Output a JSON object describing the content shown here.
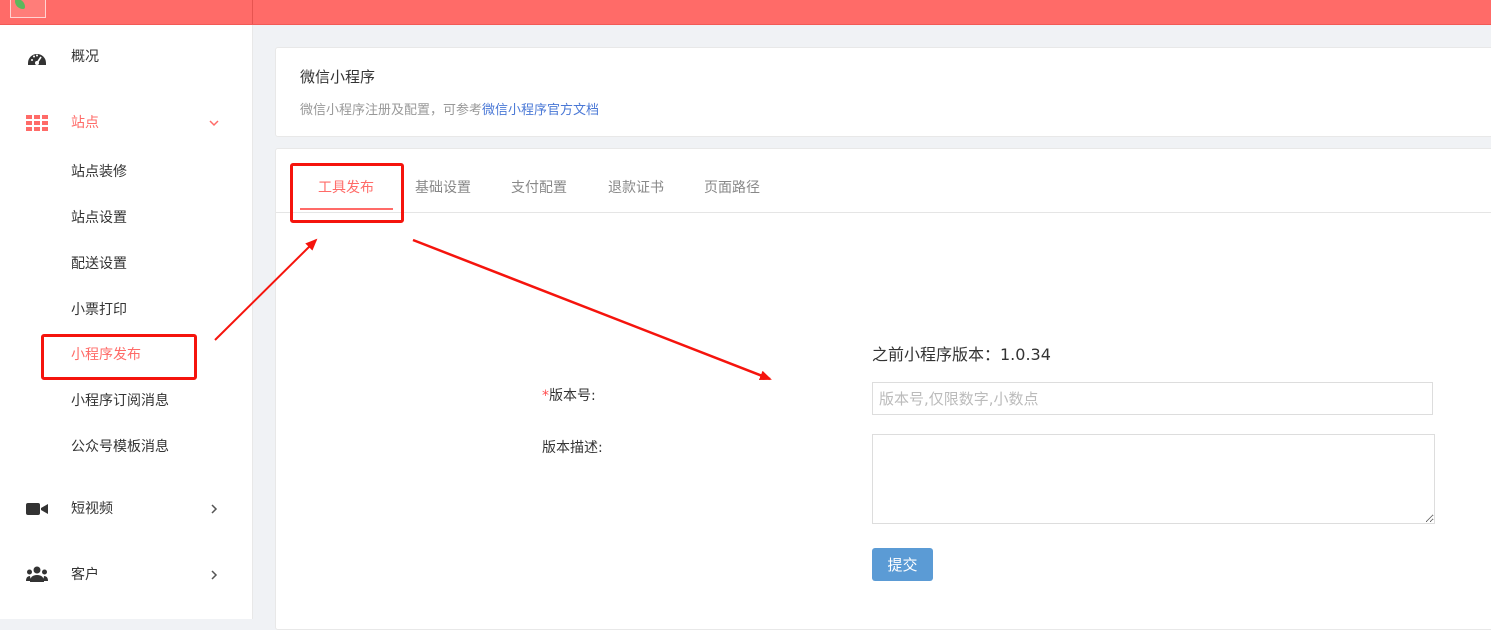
{
  "topbar": {
    "brand_text": ""
  },
  "sidebar": {
    "items": [
      {
        "label": "概况",
        "icon": "dashboard-icon"
      },
      {
        "label": "站点",
        "icon": "grid-icon",
        "active": true
      },
      {
        "label": "短视频",
        "icon": "video-camera-icon"
      },
      {
        "label": "客户",
        "icon": "users-icon"
      }
    ],
    "sub_items": [
      {
        "label": "站点装修"
      },
      {
        "label": "站点设置"
      },
      {
        "label": "配送设置"
      },
      {
        "label": "小票打印"
      },
      {
        "label": "小程序发布",
        "active": true
      },
      {
        "label": "小程序订阅消息"
      },
      {
        "label": "公众号模板消息"
      }
    ]
  },
  "header_card": {
    "title": "微信小程序",
    "desc_prefix": "微信小程序注册及配置，可参考",
    "desc_link": "微信小程序官方文档"
  },
  "tabs": [
    {
      "label": "工具发布",
      "active": true
    },
    {
      "label": "基础设置"
    },
    {
      "label": "支付配置"
    },
    {
      "label": "退款证书"
    },
    {
      "label": "页面路径"
    }
  ],
  "form": {
    "prev_version": "之前小程序版本：1.0.34",
    "version_required_mark": "*",
    "version_label": "版本号:",
    "version_placeholder": "版本号,仅限数字,小数点",
    "version_value": "",
    "desc_label": "版本描述:",
    "desc_value": "",
    "submit_label": "提交"
  },
  "colors": {
    "brand": "#ff6b68",
    "link": "#4a78d6",
    "submit": "#5b9bd5",
    "annotation": "#f5140d"
  }
}
